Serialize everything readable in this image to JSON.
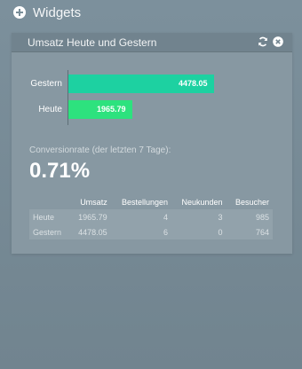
{
  "topbar": {
    "title": "Widgets",
    "add_icon": "plus-circle-icon"
  },
  "widget": {
    "title": "Umsatz Heute und Gestern",
    "refresh_icon": "refresh-icon",
    "close_icon": "close-icon",
    "chart_data": {
      "type": "bar",
      "orientation": "horizontal",
      "categories": [
        "Gestern",
        "Heute"
      ],
      "values": [
        4478.05,
        1965.79
      ],
      "value_labels": [
        "4478.05",
        "1965.79"
      ],
      "colors": [
        "#1dd1a1",
        "#2de27e"
      ],
      "xlim": [
        0,
        4478.05
      ]
    },
    "conversion": {
      "label": "Conversionrate (der letzten 7 Tage):",
      "value": "0.71%"
    },
    "table": {
      "headers": [
        "",
        "Umsatz",
        "Bestellungen",
        "Neukunden",
        "Besucher"
      ],
      "rows": [
        [
          "Heute",
          "1965.79",
          "4",
          "3",
          "985"
        ],
        [
          "Gestern",
          "4478.05",
          "6",
          "0",
          "764"
        ]
      ]
    }
  }
}
